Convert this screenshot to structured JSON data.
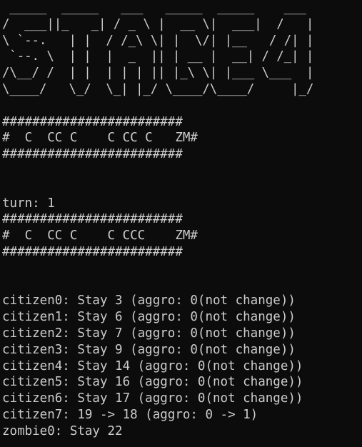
{
  "banner": [
    " _____  _____   ___   _____  _____    ___ ",
    "/  ___||_   _| / _ \\ |  __ \\|  ___|  /   |",
    "\\ `--.   | |  / /_\\ \\| |  \\/| |__   / /| |",
    " `--. \\  | |  |  _  || | __ |  __| / /_| |",
    "/\\__/ /  | |  | | | || |_\\ \\| |___ \\___  |",
    "\\____/   \\_/  \\_| |_/ \\____/\\____/     |_/"
  ],
  "board_initial": {
    "border_top": "########################",
    "row": "#  C  CC C    C CC C   ZM#",
    "border_bottom": "########################"
  },
  "turn_label": "turn: 1",
  "board_after": {
    "border_top": "########################",
    "row": "#  C  CC C    C CCC    ZM#",
    "border_bottom": "########################"
  },
  "log": [
    "citizen0: Stay 3 (aggro: 0(not change))",
    "citizen1: Stay 6 (aggro: 0(not change))",
    "citizen2: Stay 7 (aggro: 0(not change))",
    "citizen3: Stay 9 (aggro: 0(not change))",
    "citizen4: Stay 14 (aggro: 0(not change))",
    "citizen5: Stay 16 (aggro: 0(not change))",
    "citizen6: Stay 17 (aggro: 0(not change))",
    "citizen7: 19 -> 18 (aggro: 0 -> 1)",
    "zombie0: Stay 22"
  ]
}
